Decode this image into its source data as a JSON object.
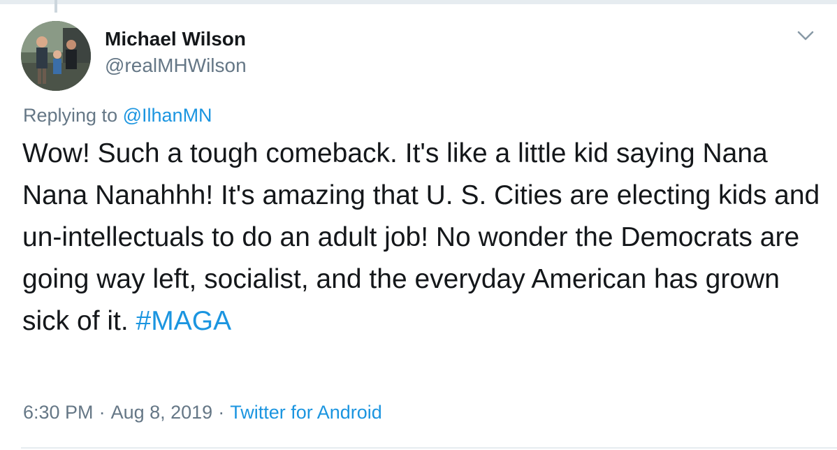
{
  "tweet": {
    "author_name": "Michael Wilson",
    "author_handle": "@realMHWilson",
    "replying_prefix": "Replying to",
    "replying_to": "@IlhanMN",
    "text_body": "Wow! Such a tough comeback. It's like a little kid saying Nana Nana Nanahhh! It's amazing that U. S. Cities are electing kids and un-intellectuals to do an adult job! No wonder the Democrats are going way left, socialist, and the everyday American has grown sick of it. ",
    "hashtag": "#MAGA",
    "time": "6:30 PM",
    "date": "Aug 8, 2019",
    "separator": "·",
    "source": "Twitter for Android"
  },
  "icons": {
    "menu": "chevron-down-icon",
    "avatar": "avatar"
  },
  "colors": {
    "link": "#1b95e0",
    "secondary_text": "#657786",
    "primary_text": "#14171a",
    "border": "#e6ecf0"
  }
}
